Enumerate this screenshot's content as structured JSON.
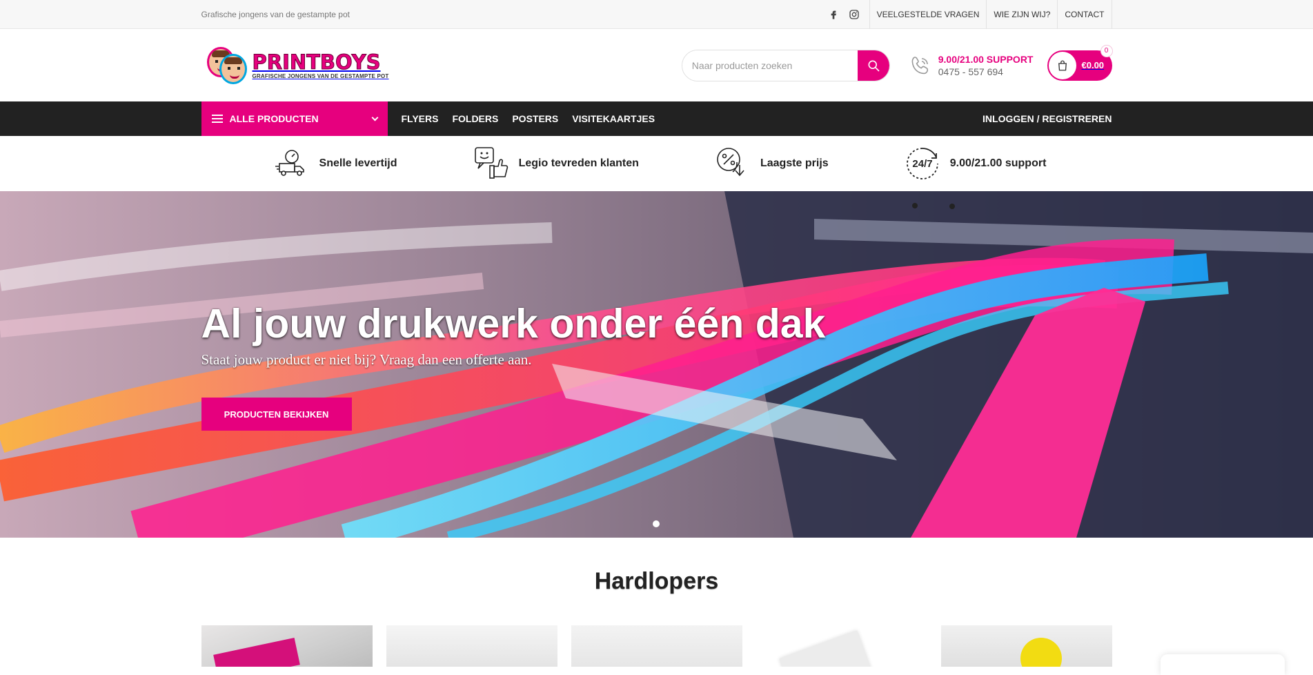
{
  "topbar": {
    "tagline": "Grafische jongens van de gestampte pot",
    "social_icons": [
      "facebook-icon",
      "instagram-icon"
    ],
    "links": [
      "VEELGESTELDE VRAGEN",
      "WIE ZIJN WIJ?",
      "CONTACT"
    ]
  },
  "header": {
    "logo": {
      "brand": "PRINTBOYS",
      "sub": "GRAFISCHE JONGENS VAN DE GESTAMPTE POT"
    },
    "search": {
      "placeholder": "Naar producten zoeken",
      "value": ""
    },
    "support": {
      "title": "9.00/21.00 SUPPORT",
      "phone": "0475 - 557 694"
    },
    "cart": {
      "total": "€0.00",
      "count": "0"
    }
  },
  "nav": {
    "all_products": "ALLE PRODUCTEN",
    "links": [
      "FLYERS",
      "FOLDERS",
      "POSTERS",
      "VISITEKAARTJES"
    ],
    "login": "INLOGGEN / REGISTREREN"
  },
  "usps": [
    {
      "icon": "fast-delivery-icon",
      "label": "Snelle levertijd"
    },
    {
      "icon": "happy-customer-icon",
      "label": "Legio tevreden klanten"
    },
    {
      "icon": "discount-icon",
      "label": "Laagste prijs"
    },
    {
      "icon": "24-7-icon",
      "label": "9.00/21.00 support"
    }
  ],
  "hero": {
    "title": "Al jouw drukwerk onder één dak",
    "subtitle": "Staat jouw product er niet bij? Vraag dan een offerte aan.",
    "button": "PRODUCTEN BEKIJKEN",
    "active_slide": 1,
    "slide_count": 1
  },
  "section": {
    "title": "Hardlopers"
  },
  "colors": {
    "accent": "#e6007e",
    "nav_bg": "#222222",
    "topbar_bg": "#f7f7f7"
  }
}
